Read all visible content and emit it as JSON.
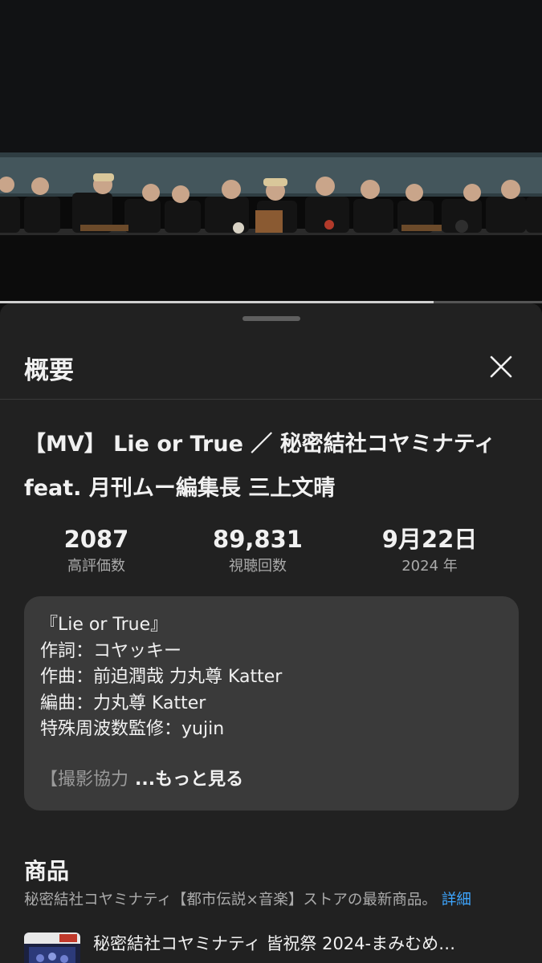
{
  "video": {
    "thumbnail_icon": "video-frame-image",
    "progress": 0.8
  },
  "sheet": {
    "title": "概要",
    "close_icon": "close-icon"
  },
  "video_info": {
    "title": "【MV】 Lie or True ／ 秘密結社コヤミナティ feat. 月刊ムー編集長 三上文晴",
    "stats": {
      "likes_value": "2087",
      "likes_label": "高評価数",
      "views_value": "89,831",
      "views_label": "視聴回数",
      "date_value": "9月22日",
      "date_label": "2024 年"
    }
  },
  "description": {
    "lines": [
      "『Lie or True』",
      "作詞：コヤッキー",
      "作曲：前迫潤哉 力丸尊 Katter",
      "編曲：力丸尊 Katter",
      "特殊周波数監修：yujin",
      ""
    ],
    "truncated_text": "【撮影協力",
    "more_label": "...もっと見る"
  },
  "products": {
    "heading": "商品",
    "subtitle": "秘密結社コヤミナティ【都市伝説×音楽】ストアの最新商品。",
    "detail_link": "詳細",
    "items": [
      {
        "name": "秘密結社コヤミナティ 皆祝祭 2024-まみむめ…"
      }
    ]
  },
  "colors": {
    "background": "#0f0f0f",
    "sheet": "#212121",
    "card": "#3a3a3a",
    "link": "#3ea6ff",
    "secondary_text": "#aaaaaa"
  }
}
